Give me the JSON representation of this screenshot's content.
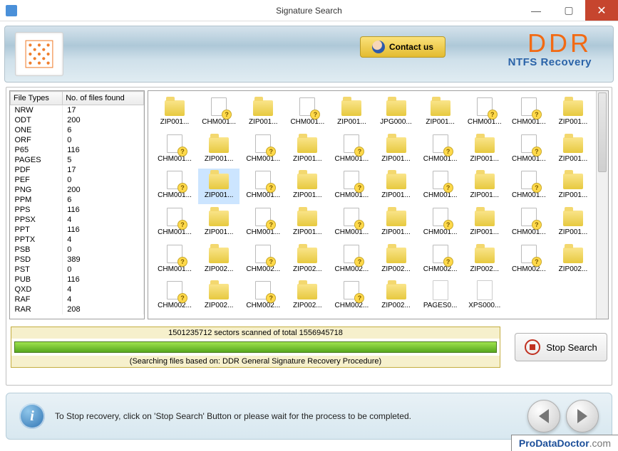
{
  "titlebar": {
    "title": "Signature Search"
  },
  "header": {
    "contact_label": "Contact us",
    "brand_main": "DDR",
    "brand_sub": "NTFS Recovery"
  },
  "table": {
    "col1": "File Types",
    "col2": "No. of files found",
    "rows": [
      {
        "t": "NRW",
        "n": "17"
      },
      {
        "t": "ODT",
        "n": "200"
      },
      {
        "t": "ONE",
        "n": "6"
      },
      {
        "t": "ORF",
        "n": "0"
      },
      {
        "t": "P65",
        "n": "116"
      },
      {
        "t": "PAGES",
        "n": "5"
      },
      {
        "t": "PDF",
        "n": "17"
      },
      {
        "t": "PEF",
        "n": "0"
      },
      {
        "t": "PNG",
        "n": "200"
      },
      {
        "t": "PPM",
        "n": "6"
      },
      {
        "t": "PPS",
        "n": "116"
      },
      {
        "t": "PPSX",
        "n": "4"
      },
      {
        "t": "PPT",
        "n": "116"
      },
      {
        "t": "PPTX",
        "n": "4"
      },
      {
        "t": "PSB",
        "n": "0"
      },
      {
        "t": "PSD",
        "n": "389"
      },
      {
        "t": "PST",
        "n": "0"
      },
      {
        "t": "PUB",
        "n": "116"
      },
      {
        "t": "QXD",
        "n": "4"
      },
      {
        "t": "RAF",
        "n": "4"
      },
      {
        "t": "RAR",
        "n": "208"
      }
    ]
  },
  "grid_rows": [
    [
      "ZIP001...",
      "CHM001...",
      "ZIP001...",
      "CHM001...",
      "ZIP001...",
      "JPG000...",
      "ZIP001...",
      "CHM001...",
      "CHM001...",
      "ZIP001..."
    ],
    [
      "CHM001...",
      "ZIP001...",
      "CHM001...",
      "ZIP001...",
      "CHM001...",
      "ZIP001...",
      "CHM001...",
      "ZIP001...",
      "CHM001...",
      "ZIP001..."
    ],
    [
      "CHM001...",
      "ZIP001...",
      "CHM001...",
      "ZIP001...",
      "CHM001...",
      "ZIP001...",
      "CHM001...",
      "ZIP001...",
      "CHM001...",
      "ZIP001..."
    ],
    [
      "CHM001...",
      "ZIP001...",
      "CHM001...",
      "ZIP001...",
      "CHM001...",
      "ZIP001...",
      "CHM001...",
      "ZIP001...",
      "CHM001...",
      "ZIP001..."
    ],
    [
      "CHM001...",
      "ZIP002...",
      "CHM002...",
      "ZIP002...",
      "CHM002...",
      "ZIP002...",
      "CHM002...",
      "ZIP002...",
      "CHM002...",
      "ZIP002..."
    ],
    [
      "CHM002...",
      "ZIP002...",
      "CHM002...",
      "ZIP002...",
      "CHM002...",
      "ZIP002...",
      "PAGES0...",
      "XPS000...",
      "",
      ""
    ]
  ],
  "selected_cell": {
    "row": 2,
    "col": 1
  },
  "progress": {
    "line1": "1501235712 sectors scanned of total 1556945718",
    "line2": "(Searching files based on:  DDR General Signature Recovery Procedure)"
  },
  "stop_label": "Stop Search",
  "footer_msg": "To Stop recovery, click on 'Stop Search' Button or please wait for the process to be completed.",
  "site": {
    "main": "ProDataDoctor",
    "ext": ".com"
  }
}
